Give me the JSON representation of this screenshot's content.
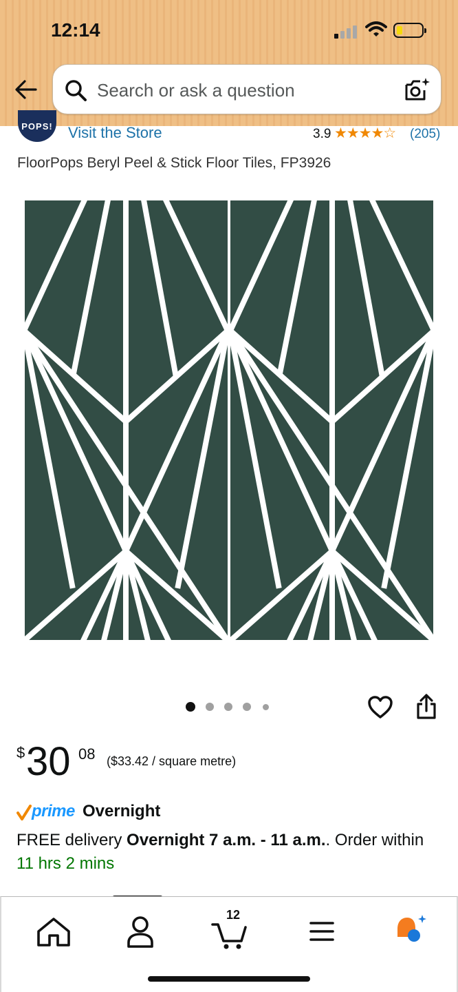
{
  "status_bar": {
    "time": "12:14"
  },
  "search": {
    "placeholder": "Search or ask a question"
  },
  "store": {
    "logo_text": "POPS!",
    "visit_label": "Visit the Store"
  },
  "rating": {
    "value": "3.9",
    "stars": 3.9,
    "count_label": "(205)"
  },
  "product": {
    "title": "FloorPops Beryl Peel & Stick Floor Tiles, FP3926"
  },
  "image_carousel": {
    "total": 5,
    "active_index": 0
  },
  "price": {
    "symbol": "$",
    "whole": "30",
    "fraction": "08",
    "unit_price": "($33.42 / square metre)"
  },
  "delivery": {
    "prime_label": "prime",
    "speed_label": "Overnight",
    "free_prefix": "FREE delivery ",
    "window": "Overnight 7 a.m. - 11 a.m.",
    "suffix": ". Order within",
    "countdown": "11 hrs 2 mins"
  },
  "bottom_nav": {
    "items": [
      "home-icon",
      "account-icon",
      "cart-icon",
      "menu-icon",
      "rufus-assistant-icon"
    ],
    "cart_count": "12"
  },
  "colors": {
    "header_bg": "#efbf85",
    "tile_green": "#324d45",
    "link_blue": "#1d72a8",
    "prime_blue": "#1a98ff",
    "star_orange": "#f08804",
    "countdown_green": "#007600"
  }
}
